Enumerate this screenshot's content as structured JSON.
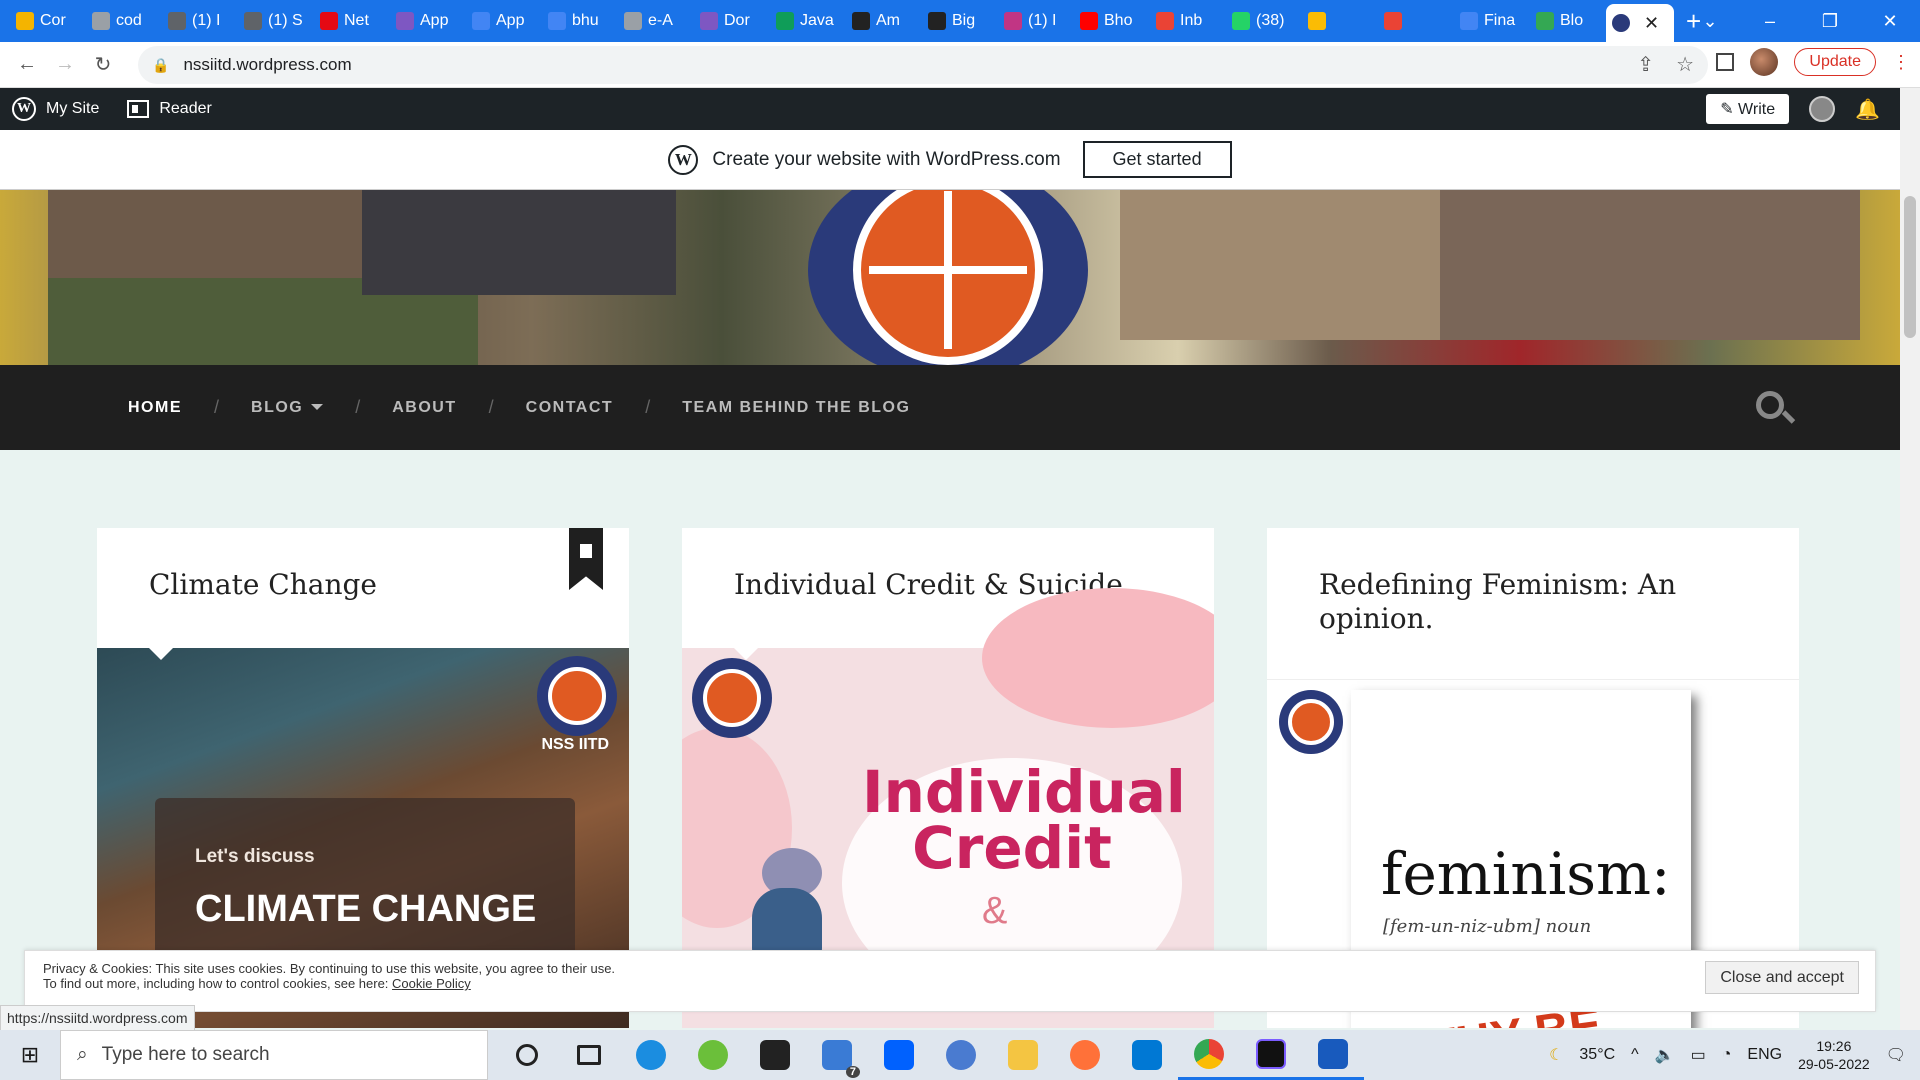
{
  "browser": {
    "tabs": [
      {
        "label": "Cor",
        "color": "#f4b400"
      },
      {
        "label": "cod",
        "color": "#9aa0a6"
      },
      {
        "label": "(1) I",
        "color": "#5f6368"
      },
      {
        "label": "(1) S",
        "color": "#5f6368"
      },
      {
        "label": "Net",
        "color": "#e50914"
      },
      {
        "label": "App",
        "color": "#7e57c2"
      },
      {
        "label": "App",
        "color": "#4285f4"
      },
      {
        "label": "bhu",
        "color": "#4285f4"
      },
      {
        "label": "e-A",
        "color": "#9aa0a6"
      },
      {
        "label": "Dor",
        "color": "#7e57c2"
      },
      {
        "label": "Java",
        "color": "#0f9d58"
      },
      {
        "label": "Am",
        "color": "#222222"
      },
      {
        "label": "Big",
        "color": "#222222"
      },
      {
        "label": "(1) I",
        "color": "#c13584"
      },
      {
        "label": "Bho",
        "color": "#ff0000"
      },
      {
        "label": "Inb",
        "color": "#ea4335"
      },
      {
        "label": "(38)",
        "color": "#25d366"
      },
      {
        "label": "",
        "color": "#fbbc04"
      },
      {
        "label": "",
        "color": "#ea4335"
      },
      {
        "label": "Fina",
        "color": "#4285f4"
      },
      {
        "label": "Blo",
        "color": "#34a853"
      }
    ],
    "active_tab_label": "",
    "url": "nssiitd.wordpress.com",
    "update_label": "Update",
    "status_url": "https://nssiitd.wordpress.com"
  },
  "wpbar": {
    "my_site": "My Site",
    "reader": "Reader",
    "write": "Write"
  },
  "banner": {
    "text": "Create your website with WordPress.com",
    "button": "Get started"
  },
  "nav": {
    "items": [
      "HOME",
      "BLOG",
      "ABOUT",
      "CONTACT",
      "TEAM BEHIND THE BLOG"
    ]
  },
  "posts": [
    {
      "title": "Climate Change",
      "img_sub": "Let's discuss",
      "img_title": "CLIMATE CHANGE",
      "badge": "NSS IITD"
    },
    {
      "title": "Individual Credit & Suicide",
      "img_title": "Individual Credit",
      "img_amp": "&"
    },
    {
      "title": "Redefining Feminism: An opinion.",
      "img_word": "feminism:",
      "img_pron": "[fem-un-niz-ubm] noun",
      "img_red": "WHY BE"
    }
  ],
  "cookie": {
    "line1": "Privacy & Cookies: This site uses cookies. By continuing to use this website, you agree to their use.",
    "line2": "To find out more, including how to control cookies, see here:",
    "link": "Cookie Policy",
    "button": "Close and accept"
  },
  "taskbar": {
    "search_placeholder": "Type here to search",
    "weather": "35°C",
    "lang": "ENG",
    "time": "19:26",
    "date": "29-05-2022",
    "mail_count": "7"
  }
}
